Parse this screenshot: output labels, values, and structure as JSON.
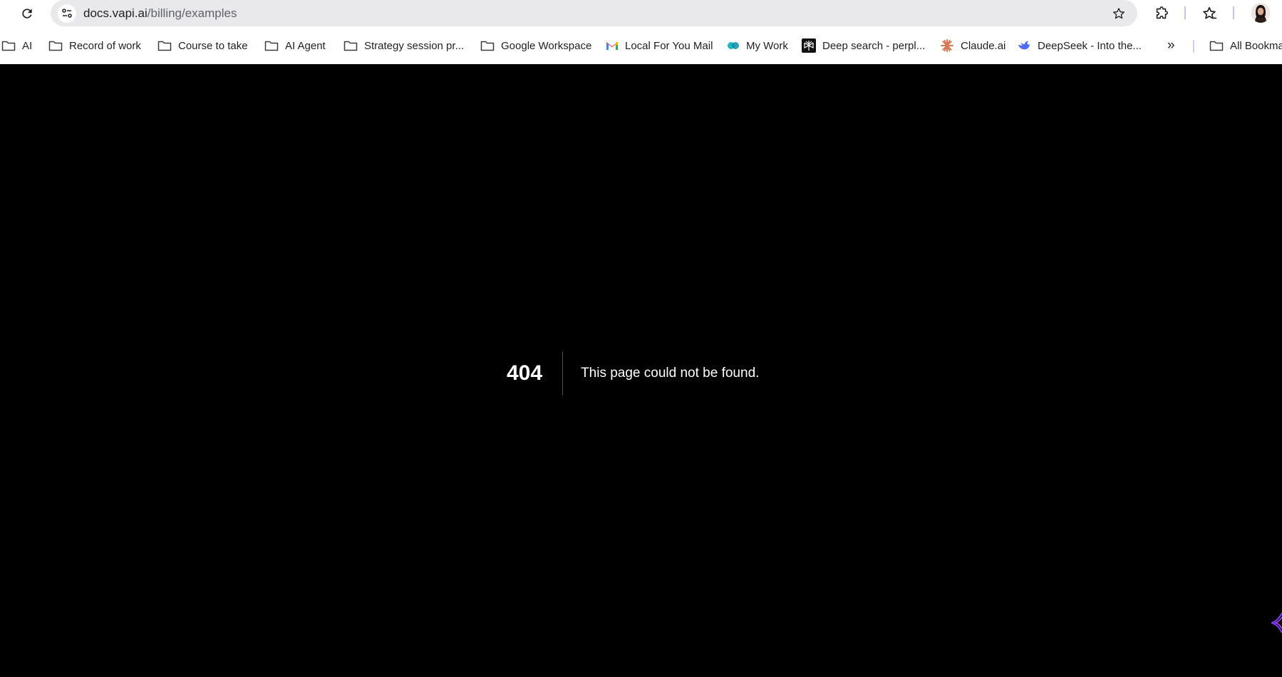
{
  "browser": {
    "url": {
      "domain": "docs.vapi.ai",
      "path": "/billing/examples"
    },
    "icons": {
      "reload": "reload-icon",
      "site_info": "site-info-icon",
      "bookmark_star": "star-icon",
      "extensions": "puzzle-icon",
      "bookmarks_manager": "star-list-icon"
    }
  },
  "bookmarks": {
    "items": [
      {
        "label": "AI",
        "icon": "folder-icon"
      },
      {
        "label": "Record of work",
        "icon": "folder-icon"
      },
      {
        "label": "Course to take",
        "icon": "folder-icon"
      },
      {
        "label": "AI Agent",
        "icon": "folder-icon"
      },
      {
        "label": "Strategy session pr...",
        "icon": "folder-icon"
      },
      {
        "label": "Google Workspace",
        "icon": "folder-icon"
      },
      {
        "label": "Local For You Mail",
        "icon": "gmail-icon"
      },
      {
        "label": "My Work",
        "icon": "mywork-icon"
      },
      {
        "label": "Deep search - perpl...",
        "icon": "perplexity-icon"
      },
      {
        "label": "Claude.ai",
        "icon": "claude-icon"
      },
      {
        "label": "DeepSeek - Into the...",
        "icon": "deepseek-icon"
      }
    ],
    "overflow": "»",
    "all_bookmarks": "All Bookma"
  },
  "page": {
    "error_code": "404",
    "error_message": "This page could not be found."
  },
  "colors": {
    "page_background": "#000000",
    "omnibox": "#e9e9eb",
    "text": "#1f1f1f"
  }
}
